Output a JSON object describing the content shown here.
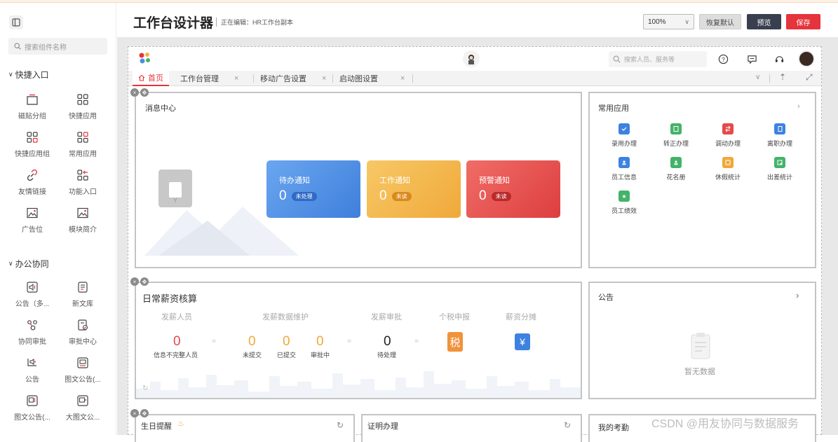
{
  "header": {
    "title": "工作台设计器",
    "editing": "正在编辑：HR工作台副本",
    "zoom": "100%",
    "reset_label": "恢复默认",
    "preview_label": "预览",
    "save_label": "保存"
  },
  "sidebar": {
    "search_placeholder": "搜索组件名称",
    "section1": "快捷入口",
    "section1_items": [
      "磁贴分组",
      "快捷应用",
      "快捷应用组",
      "常用应用",
      "友情链接",
      "功能入口",
      "广告位",
      "模块简介"
    ],
    "section2": "办公协同",
    "section2_items": [
      "公告（多...",
      "新文库",
      "协同审批",
      "审批中心",
      "公告",
      "图文公告(...",
      "图文公告(...",
      "大图文公..."
    ]
  },
  "portal": {
    "search_placeholder": "搜索人员、服务等",
    "tabs": [
      "首页",
      "工作台管理",
      "移动广告设置",
      "启动图设置"
    ]
  },
  "message_center": {
    "title": "消息中心",
    "tiles": [
      {
        "title": "待办通知",
        "value": "0",
        "badge": "未处理",
        "color": "#4d8fe3"
      },
      {
        "title": "工作通知",
        "value": "0",
        "badge": "未读",
        "color": "#f2b34b"
      },
      {
        "title": "预警通知",
        "value": "0",
        "badge": "未读",
        "color": "#e9524f"
      }
    ]
  },
  "common_apps": {
    "title": "常用应用",
    "items": [
      {
        "label": "录用办理",
        "color": "#3d82e0"
      },
      {
        "label": "转正办理",
        "color": "#43b36a"
      },
      {
        "label": "调动办理",
        "color": "#e5494a"
      },
      {
        "label": "离职办理",
        "color": "#3d82e0"
      },
      {
        "label": "员工信息",
        "color": "#3d82e0"
      },
      {
        "label": "花名册",
        "color": "#43b36a"
      },
      {
        "label": "休假统计",
        "color": "#f0a83a"
      },
      {
        "label": "出差统计",
        "color": "#43b36a"
      },
      {
        "label": "员工绩效",
        "color": "#43b36a"
      }
    ]
  },
  "payroll": {
    "title": "日常薪资核算",
    "steps": [
      "发薪人员",
      "发薪数据维护",
      "发薪审批",
      "个税申报",
      "薪资分摊"
    ],
    "values": [
      {
        "value": "0",
        "label": "信息不完整人员"
      },
      {
        "value": "0",
        "label": "未提交"
      },
      {
        "value": "0",
        "label": "已提交"
      },
      {
        "value": "0",
        "label": "审批中"
      },
      {
        "value": "0",
        "label": "待处理"
      }
    ]
  },
  "notice": {
    "title": "公告",
    "empty": "暂无数据"
  },
  "bottom": {
    "birthday": "生日提醒",
    "certificate": "证明办理",
    "attendance": "我的考勤"
  },
  "watermark": "CSDN @用友协同与数据服务"
}
